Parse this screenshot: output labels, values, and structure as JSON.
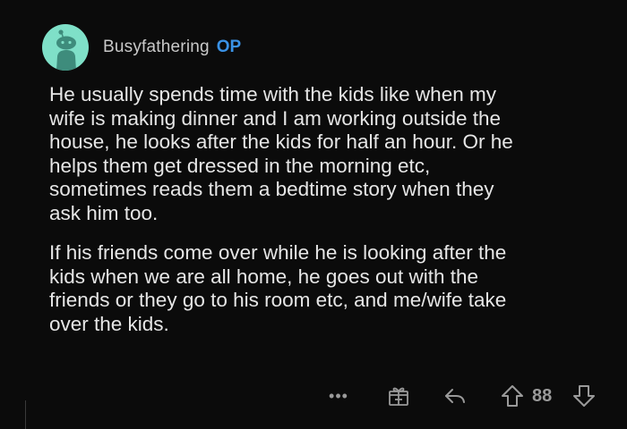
{
  "comment": {
    "author": "Busyfathering",
    "author_badge": "OP",
    "avatar_icon": "snoo-avatar-icon",
    "paragraphs": [
      "He usually spends time with the kids like when my\nwife is making dinner and I am working outside the\nhouse, he looks after the kids for half an hour. Or he\nhelps them get dressed in the morning etc,\nsometimes reads them a bedtime story when they\nask him too.",
      "If his friends come over while he is looking after the\nkids when we are all home, he goes out with the\nfriends or they go to his room etc, and me/wife take\nover the kids."
    ]
  },
  "actions": {
    "more_label": "•••",
    "award_icon": "gift-icon",
    "reply_icon": "reply-arrow-icon",
    "upvote_icon": "upvote-arrow-icon",
    "score": "88",
    "downvote_icon": "downvote-arrow-icon"
  },
  "colors": {
    "background": "#0b0b0b",
    "avatar_bg": "#7fe0c8",
    "op_badge": "#3a92e6",
    "text": "#e6e6e6",
    "muted": "#9a9a9a"
  }
}
